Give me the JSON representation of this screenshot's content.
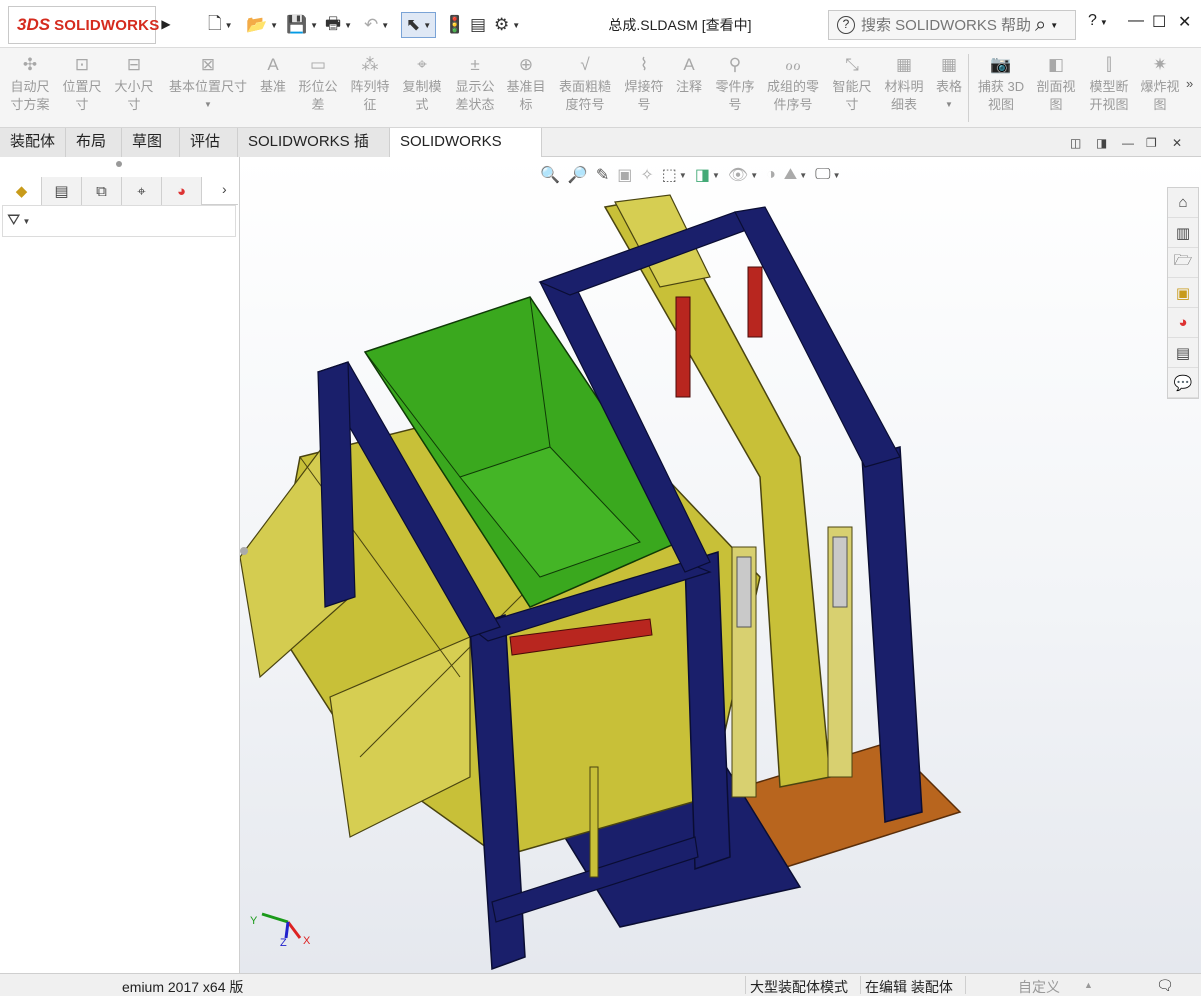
{
  "app": {
    "logo_prefix": "3DS",
    "logo_text": "SOLIDWORKS",
    "window_title": "总成.SLDASM [查看中]"
  },
  "search": {
    "placeholder": "搜索 SOLIDWORKS 帮助"
  },
  "ribbon": {
    "buttons": [
      {
        "label": "自动尺\n寸方案",
        "icon": "auto-dimension-icon"
      },
      {
        "label": "位置尺\n寸",
        "icon": "location-dimension-icon"
      },
      {
        "label": "大小尺\n寸",
        "icon": "size-dimension-icon"
      },
      {
        "label": "基本位置尺寸",
        "icon": "basic-location-dimension-icon"
      },
      {
        "label": "基准",
        "icon": "datum-icon"
      },
      {
        "label": "形位公\n差",
        "icon": "geometric-tolerance-icon"
      },
      {
        "label": "阵列特\n征",
        "icon": "pattern-feature-icon"
      },
      {
        "label": "复制模\n式",
        "icon": "copy-scheme-icon"
      },
      {
        "label": "显示公\n差状态",
        "icon": "tolerance-status-icon"
      },
      {
        "label": "基准目\n标",
        "icon": "datum-target-icon"
      },
      {
        "label": "表面粗糙\n度符号",
        "icon": "surface-finish-icon"
      },
      {
        "label": "焊接符\n号",
        "icon": "weld-symbol-icon"
      },
      {
        "label": "注释",
        "icon": "note-icon"
      },
      {
        "label": "零件序\n号",
        "icon": "balloon-icon"
      },
      {
        "label": "成组的零\n件序号",
        "icon": "stacked-balloon-icon"
      },
      {
        "label": "智能尺\n寸",
        "icon": "smart-dimension-icon"
      },
      {
        "label": "材料明\n细表",
        "icon": "bill-of-materials-icon"
      },
      {
        "label": "表格",
        "icon": "table-icon"
      },
      {
        "label": "捕获 3D\n视图",
        "icon": "capture-3d-view-icon"
      },
      {
        "label": "剖面视\n图",
        "icon": "section-view-icon"
      },
      {
        "label": "模型断\n开视图",
        "icon": "model-break-view-icon"
      },
      {
        "label": "爆炸视\n图",
        "icon": "exploded-view-icon"
      }
    ]
  },
  "tabs": [
    {
      "label": "装配体"
    },
    {
      "label": "布局"
    },
    {
      "label": "草图"
    },
    {
      "label": "评估"
    },
    {
      "label": "SOLIDWORKS 插件"
    },
    {
      "label": "SOLIDWORKS MBD"
    }
  ],
  "triad": {
    "x": "X",
    "y": "Y",
    "z": "Z"
  },
  "status": {
    "version": "emium 2017 x64 版",
    "mode": "大型装配体模式",
    "editing": "在编辑 装配体",
    "custom": "自定义"
  },
  "colors": {
    "frame": "#1a1f6b",
    "hopper": "#3aa81e",
    "machine": "#c8c038",
    "rod": "#b8261f",
    "base": "#b8651e"
  }
}
